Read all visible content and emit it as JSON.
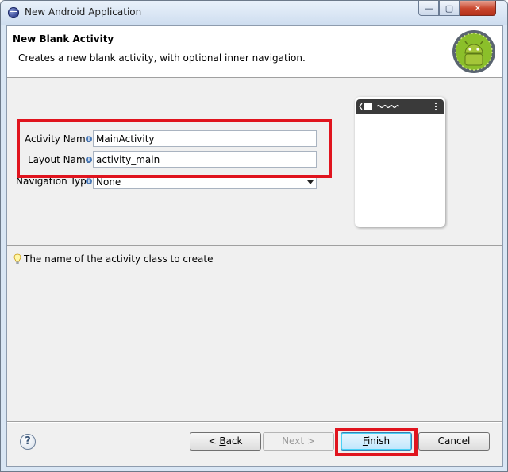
{
  "window": {
    "title": "New Android Application",
    "controls": {
      "minimize": "—",
      "maximize": "▢",
      "close": "✕"
    }
  },
  "header": {
    "title": "New Blank Activity",
    "description": "Creates a new blank activity, with optional inner navigation."
  },
  "form": {
    "activity_name": {
      "label": "Activity Name",
      "value": "MainActivity"
    },
    "layout_name": {
      "label": "Layout Name",
      "value": "activity_main"
    },
    "navigation_type": {
      "label": "Navigation Type",
      "value": "None"
    },
    "info_glyph": "i"
  },
  "hint": {
    "text": "The name of the activity class to create"
  },
  "buttons": {
    "help": "?",
    "back": {
      "prefix": "< ",
      "mnemonic": "B",
      "rest": "ack"
    },
    "next": {
      "text": "Next >"
    },
    "finish": {
      "mnemonic": "F",
      "rest": "inish"
    },
    "cancel": {
      "text": "Cancel"
    }
  },
  "colors": {
    "highlight": "#e0141e",
    "android_green": "#a4c639"
  },
  "icons": [
    "eclipse-icon",
    "android-logo",
    "info-icon",
    "lightbulb-icon",
    "help-icon"
  ]
}
